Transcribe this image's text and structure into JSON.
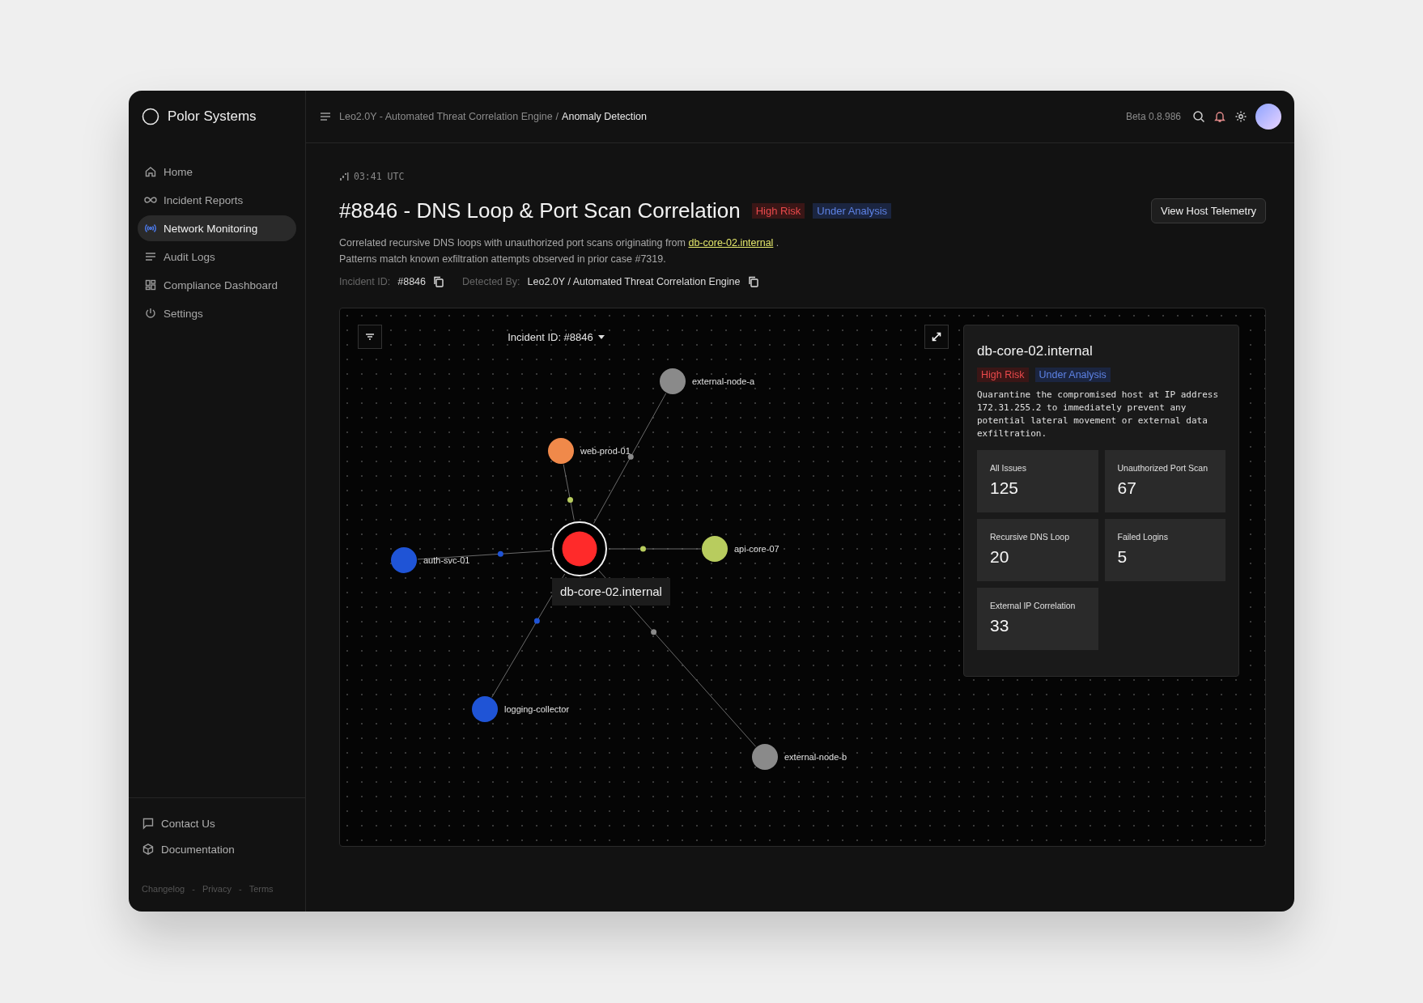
{
  "sidebar": {
    "brand": "Polor Systems",
    "items": [
      {
        "label": "Home",
        "selected": false
      },
      {
        "label": "Incident Reports",
        "selected": false
      },
      {
        "label": "Network Monitoring",
        "selected": true
      },
      {
        "label": "Audit Logs",
        "selected": false
      },
      {
        "label": "Compliance Dashboard",
        "selected": false
      },
      {
        "label": "Settings",
        "selected": false
      }
    ],
    "footer_items": [
      {
        "label": "Contact Us"
      },
      {
        "label": "Documentation"
      }
    ],
    "footer_links": [
      "Changelog",
      "Privacy",
      "Terms"
    ],
    "link_separator": "-"
  },
  "header": {
    "breadcrumb": [
      "Leo2.0Y - Automated Threat Correlation Engine",
      "Anomaly Detection"
    ],
    "separator": "/",
    "version": "Beta 0.8.986"
  },
  "incident": {
    "time": "03:41 UTC",
    "title": "#8846 - DNS Loop & Port Scan Correlation",
    "badges": [
      {
        "label": "High Risk",
        "kind": "risk"
      },
      {
        "label": "Under Analysis",
        "kind": "status"
      }
    ],
    "action": "View Host Telemetry",
    "description": {
      "before": "Correlated recursive DNS loops with unauthorized port scans originating from",
      "link": "db-core-02.internal",
      "after": ".",
      "second_line": "Patterns match known exfiltration attempts observed in prior case #7319."
    },
    "meta": [
      {
        "label": "Incident ID:",
        "value": "#8846"
      },
      {
        "label": "Detected By:",
        "value": "Leo2.0Y / Automated Threat Correlation Engine"
      }
    ]
  },
  "graph": {
    "selector": "Incident ID: #8846",
    "center": {
      "label": "db-core-02.internal",
      "color": "#ff2a2a"
    },
    "nodes": [
      {
        "label": "external-node-a",
        "color": "#8a8a8a",
        "link": {
          "color": "#8a8a8a"
        }
      },
      {
        "label": "web-prod-01",
        "color": "#f0894a",
        "link": {
          "color": "#b8cc5e"
        }
      },
      {
        "label": "api-core-07",
        "color": "#b8cc5e",
        "link": {
          "color": "#b8cc5e"
        }
      },
      {
        "label": "auth-svc-01",
        "color": "#1f54d6",
        "link": {
          "color": "#1f54d6"
        }
      },
      {
        "label": "logging-collector",
        "color": "#1f54d6",
        "link": {
          "color": "#1f54d6"
        }
      },
      {
        "label": "external-node-b",
        "color": "#8a8a8a",
        "link": {
          "color": "#8a8a8a"
        }
      }
    ],
    "panel": {
      "title": "db-core-02.internal",
      "badges": [
        {
          "label": "High Risk",
          "kind": "risk"
        },
        {
          "label": "Under Analysis",
          "kind": "status"
        }
      ],
      "note": "Quarantine the compromised host at IP address 172.31.255.2 to immediately prevent any potential lateral movement or external data exfiltration.",
      "stats": [
        {
          "label": "All Issues",
          "value": "125"
        },
        {
          "label": "Unauthorized Port Scan",
          "value": "67"
        },
        {
          "label": "Recursive DNS Loop",
          "value": "20"
        },
        {
          "label": "Failed Logins",
          "value": "5"
        },
        {
          "label": "External IP Correlation",
          "value": "33"
        }
      ]
    }
  }
}
